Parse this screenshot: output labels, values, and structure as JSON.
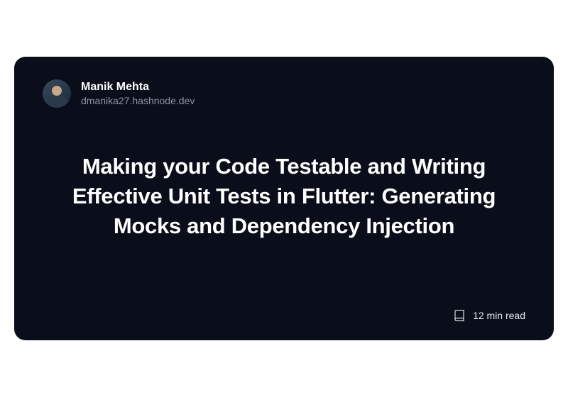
{
  "author": {
    "name": "Manik Mehta",
    "domain": "dmanika27.hashnode.dev"
  },
  "article": {
    "title": "Making your Code Testable and Writing Effective Unit Tests in Flutter: Generating Mocks and Dependency Injection",
    "read_time": "12 min read"
  }
}
